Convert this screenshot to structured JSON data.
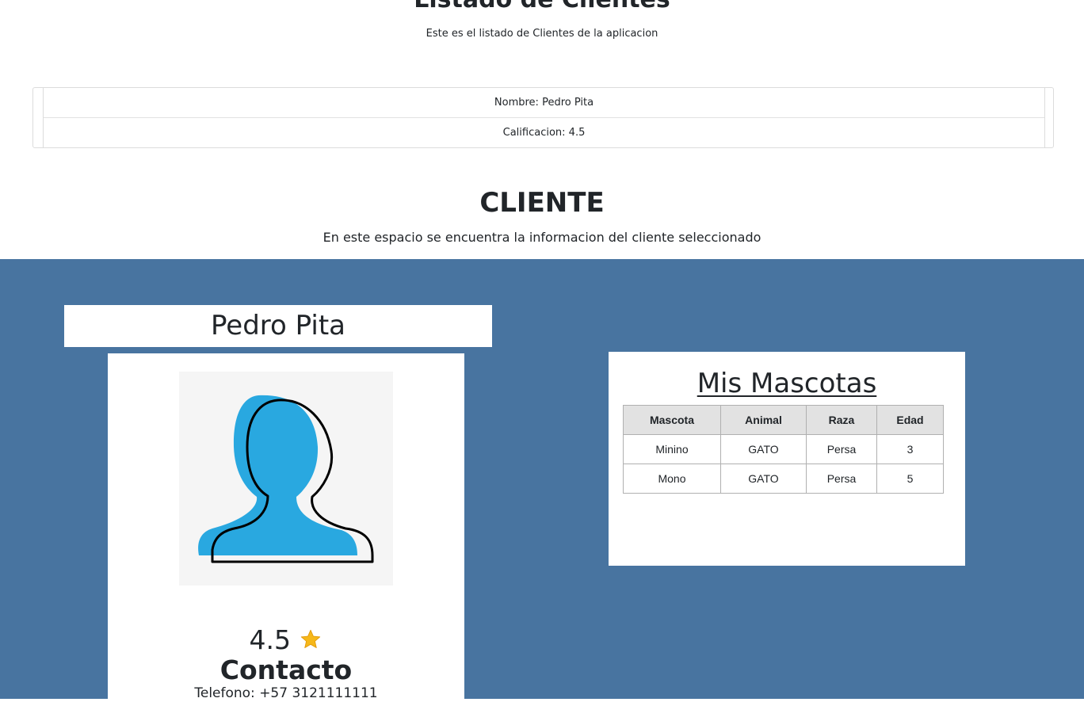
{
  "header": {
    "title": "Listado de Clientes",
    "subtitle": "Este es el listado de Clientes de la aplicacion"
  },
  "client_list": [
    {
      "text": "Nombre: Pedro Pita"
    },
    {
      "text": "Calificacion: 4.5"
    }
  ],
  "section": {
    "title": "CLIENTE",
    "subtitle": "En este espacio se encuentra la informacion del cliente seleccionado"
  },
  "profile": {
    "name": "Pedro Pita",
    "rating": "4.5",
    "contact_title": "Contacto",
    "phone": "Telefono: +57 3121111111",
    "avatar_icon": "user-silhouette-icon",
    "star_icon": "star-icon"
  },
  "pets": {
    "title": "Mis Mascotas",
    "columns": [
      "Mascota",
      "Animal",
      "Raza",
      "Edad"
    ],
    "rows": [
      [
        "Minino",
        "GATO",
        "Persa",
        "3"
      ],
      [
        "Mono",
        "GATO",
        "Persa",
        "5"
      ]
    ]
  },
  "colors": {
    "band": "#4874a0",
    "avatar_fill": "#29a8e0",
    "star": "#f6b81a"
  }
}
